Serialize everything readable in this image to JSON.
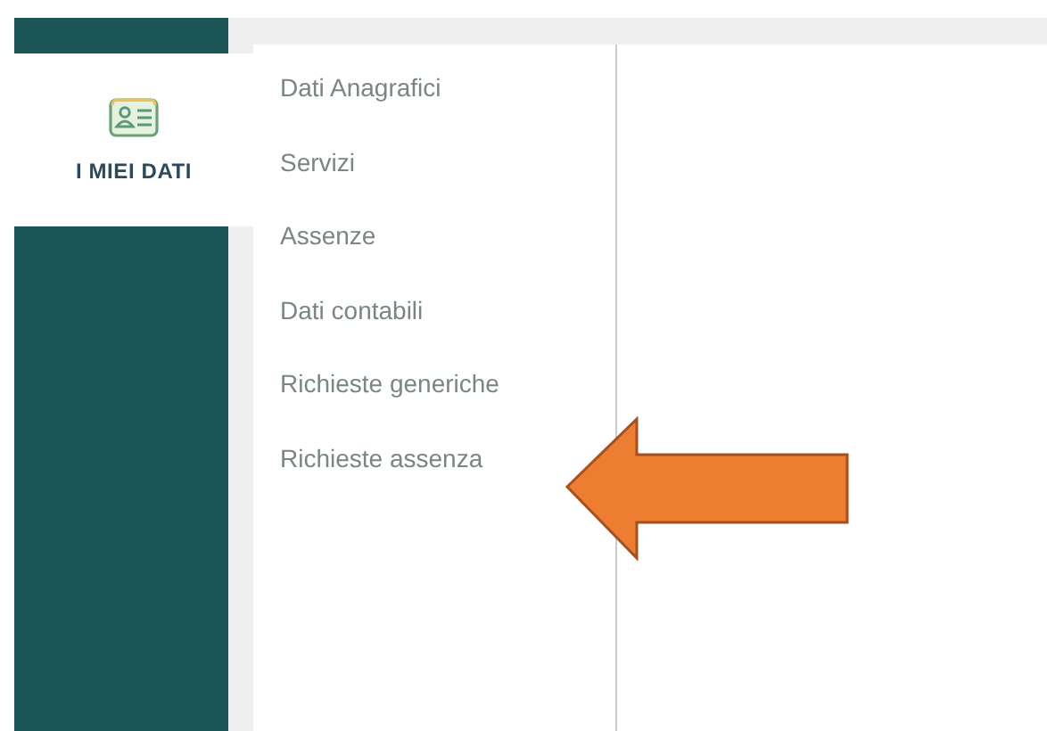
{
  "sidebar": {
    "items": [
      {
        "label": "I MIEI DATI",
        "selected": true
      }
    ]
  },
  "menu": {
    "items": [
      {
        "label": "Dati Anagrafici"
      },
      {
        "label": "Servizi"
      },
      {
        "label": "Assenze"
      },
      {
        "label": "Dati contabili"
      },
      {
        "label": "Richieste generiche"
      },
      {
        "label": "Richieste assenza"
      }
    ]
  },
  "annotation": {
    "kind": "arrow",
    "color": "#ed7d31"
  }
}
